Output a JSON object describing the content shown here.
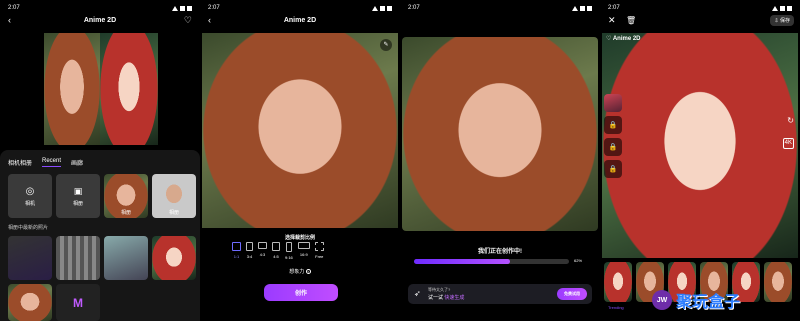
{
  "status": {
    "time": "2:07"
  },
  "s1": {
    "title": "Anime 2D",
    "tabs": [
      "相机相册",
      "Recent",
      "画廊"
    ],
    "camera_label": "相机",
    "album_label": "相册",
    "tile3_label": "相册",
    "tile4_label": "相册",
    "recent_heading": "相册中最新的照片"
  },
  "s2": {
    "title": "Anime 2D",
    "crop_heading": "选择裁剪比例",
    "crop_options": [
      "1:1",
      "3:4",
      "4:3",
      "4:5",
      "9:16",
      "16:9",
      "Free"
    ],
    "fantasy_label": "想象力",
    "create_label": "创作"
  },
  "s3": {
    "creating_text": "我们正在创作中!",
    "progress_percent": 62,
    "progress_label": "62%",
    "banner_line1": "等待太久了?",
    "banner_line2a": "试一试",
    "banner_line2b": "快速生成",
    "try_label": "免费试用"
  },
  "s4": {
    "save_label": "保存",
    "title": "Anime 2D",
    "thumb_label": "Trending"
  },
  "watermark": {
    "logo": "JW",
    "text": "聚玩盒子"
  },
  "colors": {
    "accent": "#9b3bff",
    "accent2": "#c04dff",
    "progress": "#6f2cff"
  }
}
